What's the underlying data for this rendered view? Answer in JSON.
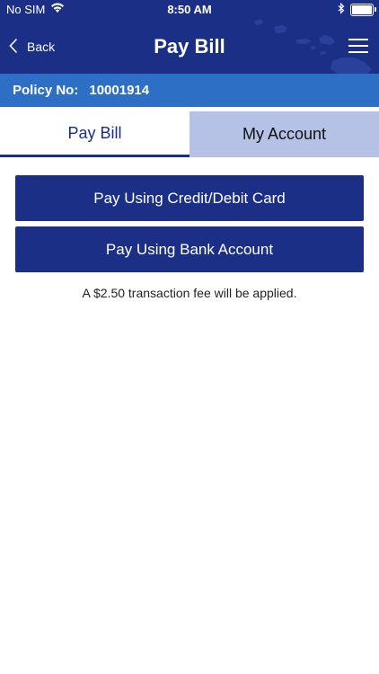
{
  "status_bar": {
    "carrier": "No SIM",
    "time": "8:50 AM",
    "wifi_icon": "wifi-icon",
    "bluetooth_icon": "bluetooth-icon",
    "battery_icon": "battery-icon"
  },
  "nav": {
    "back_label": "Back",
    "title": "Pay Bill",
    "back_icon": "chevron-left-icon",
    "menu_icon": "hamburger-menu-icon"
  },
  "policy": {
    "label": "Policy No:",
    "number": "10001914"
  },
  "tabs": [
    {
      "label": "Pay Bill",
      "active": true
    },
    {
      "label": "My Account",
      "active": false
    }
  ],
  "actions": {
    "card_label": "Pay Using Credit/Debit Card",
    "bank_label": "Pay Using Bank Account"
  },
  "fee_note": "A $2.50 transaction fee will be applied.",
  "colors": {
    "header": "#1b2f86",
    "policy_band": "#2e6fc6",
    "inactive_tab": "#b6c2e5",
    "button": "#1b2f86"
  }
}
